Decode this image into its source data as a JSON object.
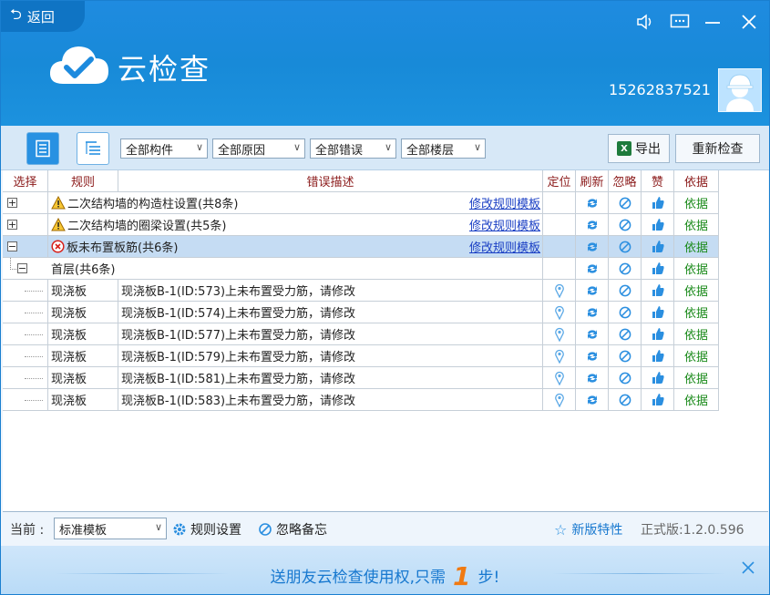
{
  "header": {
    "back_label": "返回",
    "app_title": "云检查",
    "phone": "15262837521"
  },
  "toolbar": {
    "filters": [
      "全部构件",
      "全部原因",
      "全部错误",
      "全部楼层"
    ],
    "export_label": "导出",
    "recheck_label": "重新检查"
  },
  "table": {
    "columns": {
      "select": "选择",
      "rule": "规则",
      "desc": "错误描述",
      "locate": "定位",
      "refresh": "刷新",
      "ignore": "忽略",
      "like": "赞",
      "basis": "依据"
    },
    "groups": [
      {
        "toggle": "+",
        "icon": "warning-icon",
        "title": "二次结构墙的构造柱设置(共8条)",
        "link": "修改规则模板",
        "basis": "依据"
      },
      {
        "toggle": "+",
        "icon": "warning-icon",
        "title": "二次结构墙的圈梁设置(共5条)",
        "link": "修改规则模板",
        "basis": "依据"
      },
      {
        "toggle": "−",
        "icon": "error-icon",
        "title": "板未布置板筋(共6条)",
        "link": "修改规则模板",
        "basis": "依据"
      }
    ],
    "floor": {
      "toggle": "−",
      "title": "首层(共6条)",
      "basis": "依据"
    },
    "items": [
      {
        "type": "现浇板",
        "desc": "现浇板B-1(ID:573)上未布置受力筋，请修改",
        "basis": "依据"
      },
      {
        "type": "现浇板",
        "desc": "现浇板B-1(ID:574)上未布置受力筋，请修改",
        "basis": "依据"
      },
      {
        "type": "现浇板",
        "desc": "现浇板B-1(ID:577)上未布置受力筋，请修改",
        "basis": "依据"
      },
      {
        "type": "现浇板",
        "desc": "现浇板B-1(ID:579)上未布置受力筋，请修改",
        "basis": "依据"
      },
      {
        "type": "现浇板",
        "desc": "现浇板B-1(ID:581)上未布置受力筋，请修改",
        "basis": "依据"
      },
      {
        "type": "现浇板",
        "desc": "现浇板B-1(ID:583)上未布置受力筋，请修改",
        "basis": "依据"
      }
    ]
  },
  "status": {
    "current_label": "当前 :",
    "template_value": "标准模板",
    "rule_settings": "规则设置",
    "ignore_notes": "忽略备忘",
    "new_features": "新版特性",
    "version": "正式版:1.2.0.596"
  },
  "banner": {
    "text_before": "送朋友云检查使用权,只需",
    "number": "1",
    "text_after": "步!"
  },
  "colors": {
    "header_blue": "#1c8ade",
    "header_text": "#8b1a1a",
    "link": "#1a3fc4",
    "basis_green": "#1a8a1a",
    "banner_orange": "#f07a12"
  }
}
